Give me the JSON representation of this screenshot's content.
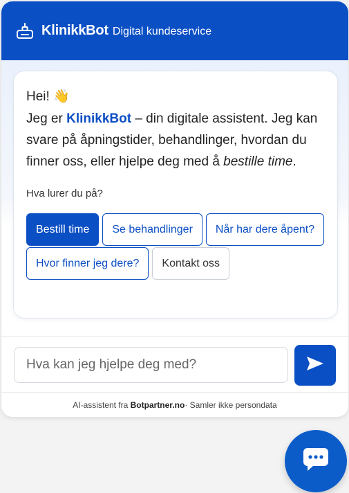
{
  "header": {
    "title": "KlinikkBot",
    "subtitle": "Digital kundeservice",
    "icon": "bot-icon"
  },
  "message": {
    "greeting": "Hei!",
    "greeting_emoji": "👋",
    "intro_prefix": "Jeg er ",
    "intro_brand": "KlinikkBot",
    "intro_middle": " – din digitale assistent. Jeg kan svare på åpningstider, behandlinger, hvordan du finner oss, eller hjelpe deg med å ",
    "intro_emphasis": "bestille time",
    "intro_suffix": ".",
    "prompt": "Hva lurer du på?"
  },
  "quick_replies": [
    {
      "label": "Bestill time",
      "style": "primary"
    },
    {
      "label": "Se behandlinger",
      "style": "outline"
    },
    {
      "label": "Når har dere åpent?",
      "style": "outline"
    },
    {
      "label": "Hvor finner jeg dere?",
      "style": "outline"
    },
    {
      "label": "Kontakt oss",
      "style": "neutral"
    }
  ],
  "input": {
    "placeholder": "Hva kan jeg hjelpe deg med?",
    "value": "",
    "send_icon": "send-icon"
  },
  "footer": {
    "prefix": "AI-assistent fra ",
    "provider": "Botpartner.no",
    "suffix": " · Samler ikke persondata"
  },
  "launcher": {
    "icon": "chat-bubble-icon"
  },
  "colors": {
    "brand": "#0b4fc4",
    "launcher": "#0b5cc9",
    "background": "#f3f3f3"
  }
}
